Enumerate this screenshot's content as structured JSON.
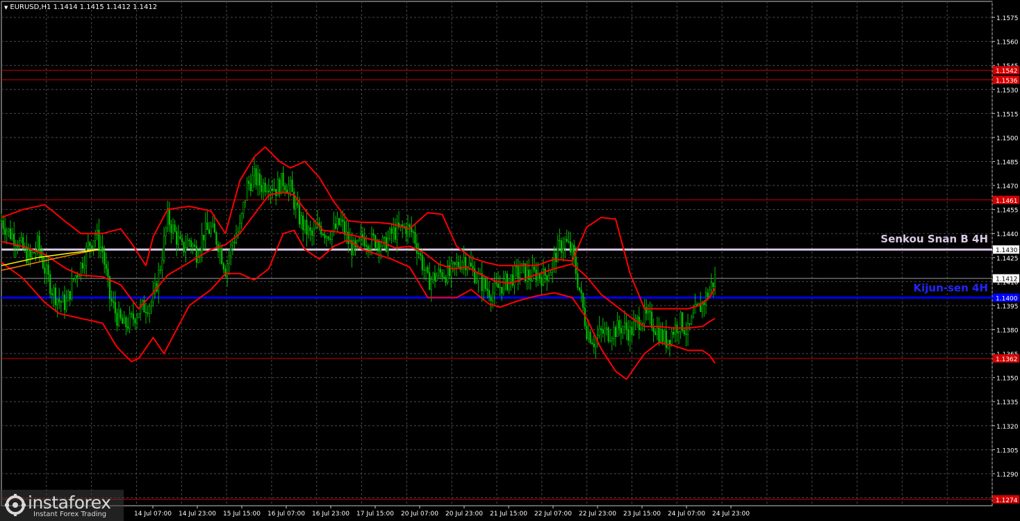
{
  "header": {
    "symbol_line": "EURUSD,H1  1.1414 1.1415 1.1412 1.1412"
  },
  "logo": {
    "name": "instaforex",
    "tagline": "Instant Forex Trading"
  },
  "chart_data": {
    "type": "candlestick",
    "symbol": "EURUSD",
    "timeframe": "H1",
    "ohlc_last": {
      "open": 1.1414,
      "high": 1.1415,
      "low": 1.1412,
      "close": 1.1412
    },
    "ylim": [
      1.127,
      1.1585
    ],
    "y_ticks": [
      "1.1575",
      "1.1560",
      "1.1545",
      "1.1530",
      "1.1515",
      "1.1500",
      "1.1485",
      "1.1470",
      "1.1455",
      "1.1440",
      "1.1425",
      "1.1410",
      "1.1395",
      "1.1380",
      "1.1365",
      "1.1350",
      "1.1335",
      "1.1320",
      "1.1305",
      "1.1290",
      "1.1275"
    ],
    "x_ticks": [
      "14 Jul 07:00",
      "14 Jul 23:00",
      "15 Jul 15:00",
      "16 Jul 07:00",
      "16 Jul 23:00",
      "17 Jul 15:00",
      "20 Jul 07:00",
      "20 Jul 23:00",
      "21 Jul 15:00",
      "22 Jul 07:00",
      "22 Jul 23:00",
      "23 Jul 15:00",
      "24 Jul 07:00",
      "24 Jul 23:00"
    ],
    "grid": true,
    "current_price": "1.1412",
    "levels": [
      {
        "price": 1.1542,
        "label": "1.1542",
        "color": "#d40000",
        "type": "support-resistance"
      },
      {
        "price": 1.1536,
        "label": "1.1536",
        "color": "#d40000",
        "type": "support-resistance"
      },
      {
        "price": 1.1461,
        "label": "1.1461",
        "color": "#d40000",
        "type": "support-resistance"
      },
      {
        "price": 1.1362,
        "label": "1.1362",
        "color": "#d40000",
        "type": "support-resistance"
      },
      {
        "price": 1.1274,
        "label": "1.1274",
        "color": "#d40000",
        "type": "support-resistance"
      },
      {
        "price": 1.143,
        "label": "1.1430",
        "color": "#d9c9e6",
        "type": "senkou-span-b",
        "annotation": "Senkou Snan B 4H"
      },
      {
        "price": 1.14,
        "label": "1.1400",
        "color": "#0000ff",
        "type": "kijun-sen",
        "annotation": "Kijun-sen 4H"
      }
    ],
    "price_series": [
      [
        0,
        1.1448
      ],
      [
        4,
        1.1441
      ],
      [
        8,
        1.1437
      ],
      [
        12,
        1.143
      ],
      [
        16,
        1.1424
      ],
      [
        20,
        1.1433
      ],
      [
        24,
        1.1418
      ],
      [
        28,
        1.1405
      ],
      [
        32,
        1.1398
      ],
      [
        36,
        1.1396
      ],
      [
        40,
        1.1412
      ],
      [
        44,
        1.142
      ],
      [
        48,
        1.1432
      ],
      [
        52,
        1.144
      ],
      [
        56,
        1.1429
      ],
      [
        60,
        1.14
      ],
      [
        64,
        1.1388
      ],
      [
        68,
        1.1382
      ],
      [
        72,
        1.1386
      ],
      [
        76,
        1.1392
      ],
      [
        80,
        1.1395
      ],
      [
        84,
        1.1398
      ],
      [
        88,
        1.142
      ],
      [
        92,
        1.145
      ],
      [
        96,
        1.144
      ],
      [
        100,
        1.143
      ],
      [
        104,
        1.1436
      ],
      [
        108,
        1.1428
      ],
      [
        112,
        1.144
      ],
      [
        116,
        1.1443
      ],
      [
        120,
        1.1434
      ],
      [
        124,
        1.1418
      ],
      [
        128,
        1.1435
      ],
      [
        132,
        1.1443
      ],
      [
        136,
        1.147
      ],
      [
        140,
        1.1475
      ],
      [
        144,
        1.147
      ],
      [
        148,
        1.1472
      ],
      [
        152,
        1.1468
      ],
      [
        156,
        1.1473
      ],
      [
        160,
        1.1468
      ],
      [
        164,
        1.1452
      ],
      [
        168,
        1.1443
      ],
      [
        172,
        1.1438
      ],
      [
        176,
        1.1445
      ],
      [
        180,
        1.144
      ],
      [
        184,
        1.1442
      ],
      [
        188,
        1.1447
      ],
      [
        192,
        1.1435
      ],
      [
        196,
        1.1428
      ],
      [
        200,
        1.1438
      ],
      [
        204,
        1.1435
      ],
      [
        208,
        1.1436
      ],
      [
        212,
        1.1432
      ],
      [
        216,
        1.144
      ],
      [
        220,
        1.1442
      ],
      [
        224,
        1.1444
      ],
      [
        228,
        1.144
      ],
      [
        232,
        1.1425
      ],
      [
        236,
        1.141
      ],
      [
        240,
        1.1413
      ],
      [
        244,
        1.1416
      ],
      [
        248,
        1.1414
      ],
      [
        252,
        1.142
      ],
      [
        256,
        1.1425
      ],
      [
        260,
        1.1418
      ],
      [
        264,
        1.1412
      ],
      [
        268,
        1.1406
      ],
      [
        272,
        1.1403
      ],
      [
        276,
        1.1407
      ],
      [
        280,
        1.141
      ],
      [
        284,
        1.1414
      ],
      [
        288,
        1.1417
      ],
      [
        292,
        1.1413
      ],
      [
        296,
        1.1415
      ],
      [
        300,
        1.1413
      ],
      [
        304,
        1.1418
      ],
      [
        308,
        1.143
      ],
      [
        312,
        1.1435
      ],
      [
        316,
        1.1428
      ],
      [
        320,
        1.1405
      ],
      [
        324,
        1.138
      ],
      [
        328,
        1.1373
      ],
      [
        332,
        1.1378
      ],
      [
        336,
        1.1378
      ],
      [
        340,
        1.138
      ],
      [
        344,
        1.1382
      ],
      [
        348,
        1.1378
      ],
      [
        352,
        1.1385
      ],
      [
        356,
        1.1388
      ],
      [
        360,
        1.1385
      ],
      [
        364,
        1.1378
      ],
      [
        368,
        1.1373
      ],
      [
        372,
        1.138
      ],
      [
        376,
        1.1385
      ],
      [
        380,
        1.1378
      ],
      [
        384,
        1.139
      ],
      [
        388,
        1.1396
      ],
      [
        392,
        1.1405
      ],
      [
        395,
        1.1412
      ]
    ],
    "bollinger_upper": [
      [
        0,
        1.145
      ],
      [
        12,
        1.1455
      ],
      [
        24,
        1.1458
      ],
      [
        36,
        1.1447
      ],
      [
        44,
        1.144
      ],
      [
        56,
        1.144
      ],
      [
        66,
        1.1443
      ],
      [
        72,
        1.1434
      ],
      [
        80,
        1.142
      ],
      [
        84,
        1.1438
      ],
      [
        92,
        1.1455
      ],
      [
        104,
        1.1457
      ],
      [
        116,
        1.1454
      ],
      [
        124,
        1.144
      ],
      [
        132,
        1.1473
      ],
      [
        140,
        1.1488
      ],
      [
        146,
        1.1494
      ],
      [
        154,
        1.1485
      ],
      [
        160,
        1.1481
      ],
      [
        168,
        1.1485
      ],
      [
        176,
        1.1475
      ],
      [
        184,
        1.146
      ],
      [
        192,
        1.1448
      ],
      [
        200,
        1.1447
      ],
      [
        208,
        1.1447
      ],
      [
        216,
        1.1446
      ],
      [
        226,
        1.1443
      ],
      [
        236,
        1.1453
      ],
      [
        244,
        1.1452
      ],
      [
        252,
        1.1432
      ],
      [
        260,
        1.1425
      ],
      [
        268,
        1.1422
      ],
      [
        276,
        1.142
      ],
      [
        284,
        1.142
      ],
      [
        296,
        1.142
      ],
      [
        306,
        1.1424
      ],
      [
        316,
        1.1423
      ],
      [
        324,
        1.1444
      ],
      [
        332,
        1.145
      ],
      [
        340,
        1.1449
      ],
      [
        348,
        1.1415
      ],
      [
        356,
        1.1393
      ],
      [
        364,
        1.1393
      ],
      [
        372,
        1.1393
      ],
      [
        380,
        1.1393
      ],
      [
        386,
        1.1395
      ],
      [
        392,
        1.14
      ],
      [
        395,
        1.1406
      ]
    ],
    "bollinger_middle": [
      [
        0,
        1.1435
      ],
      [
        12,
        1.1432
      ],
      [
        24,
        1.1427
      ],
      [
        36,
        1.1418
      ],
      [
        44,
        1.1414
      ],
      [
        56,
        1.1413
      ],
      [
        66,
        1.1408
      ],
      [
        76,
        1.1393
      ],
      [
        84,
        1.1403
      ],
      [
        92,
        1.1414
      ],
      [
        104,
        1.1422
      ],
      [
        116,
        1.143
      ],
      [
        124,
        1.1433
      ],
      [
        132,
        1.144
      ],
      [
        140,
        1.1452
      ],
      [
        148,
        1.1464
      ],
      [
        156,
        1.1466
      ],
      [
        162,
        1.1464
      ],
      [
        170,
        1.1452
      ],
      [
        178,
        1.1442
      ],
      [
        186,
        1.1441
      ],
      [
        194,
        1.1439
      ],
      [
        202,
        1.1437
      ],
      [
        210,
        1.1435
      ],
      [
        218,
        1.1431
      ],
      [
        226,
        1.1432
      ],
      [
        234,
        1.1428
      ],
      [
        242,
        1.1421
      ],
      [
        250,
        1.1418
      ],
      [
        258,
        1.1419
      ],
      [
        266,
        1.1414
      ],
      [
        274,
        1.141
      ],
      [
        282,
        1.1409
      ],
      [
        290,
        1.1412
      ],
      [
        298,
        1.1415
      ],
      [
        306,
        1.1418
      ],
      [
        316,
        1.1421
      ],
      [
        324,
        1.1413
      ],
      [
        332,
        1.1402
      ],
      [
        340,
        1.1395
      ],
      [
        348,
        1.1388
      ],
      [
        356,
        1.1382
      ],
      [
        364,
        1.1382
      ],
      [
        372,
        1.1381
      ],
      [
        380,
        1.1381
      ],
      [
        388,
        1.1382
      ],
      [
        392,
        1.1385
      ],
      [
        395,
        1.1387
      ]
    ],
    "bollinger_lower": [
      [
        0,
        1.1422
      ],
      [
        12,
        1.1412
      ],
      [
        24,
        1.1397
      ],
      [
        32,
        1.139
      ],
      [
        44,
        1.1387
      ],
      [
        56,
        1.1384
      ],
      [
        64,
        1.1369
      ],
      [
        72,
        1.136
      ],
      [
        76,
        1.1362
      ],
      [
        84,
        1.1375
      ],
      [
        90,
        1.1365
      ],
      [
        96,
        1.1378
      ],
      [
        104,
        1.1395
      ],
      [
        116,
        1.1405
      ],
      [
        124,
        1.1415
      ],
      [
        132,
        1.1415
      ],
      [
        140,
        1.1411
      ],
      [
        148,
        1.1418
      ],
      [
        156,
        1.144
      ],
      [
        162,
        1.1442
      ],
      [
        168,
        1.143
      ],
      [
        176,
        1.1424
      ],
      [
        184,
        1.1432
      ],
      [
        192,
        1.1436
      ],
      [
        200,
        1.143
      ],
      [
        208,
        1.1427
      ],
      [
        216,
        1.1424
      ],
      [
        226,
        1.1419
      ],
      [
        236,
        1.14
      ],
      [
        244,
        1.14
      ],
      [
        252,
        1.14
      ],
      [
        260,
        1.1405
      ],
      [
        270,
        1.1396
      ],
      [
        276,
        1.1394
      ],
      [
        286,
        1.1398
      ],
      [
        296,
        1.1401
      ],
      [
        306,
        1.1403
      ],
      [
        316,
        1.14
      ],
      [
        324,
        1.1387
      ],
      [
        332,
        1.1368
      ],
      [
        340,
        1.1354
      ],
      [
        346,
        1.1349
      ],
      [
        356,
        1.1365
      ],
      [
        364,
        1.1372
      ],
      [
        372,
        1.137
      ],
      [
        380,
        1.1367
      ],
      [
        388,
        1.1367
      ],
      [
        392,
        1.1364
      ],
      [
        395,
        1.1359
      ]
    ],
    "ichimoku_yellow": [
      [
        0,
        1.142
      ],
      [
        20,
        1.1425
      ],
      [
        40,
        1.1428
      ],
      [
        54,
        1.143
      ]
    ],
    "ichimoku_orange": [
      [
        0,
        1.1417
      ],
      [
        20,
        1.1422
      ],
      [
        40,
        1.1427
      ],
      [
        54,
        1.143
      ]
    ],
    "colors": {
      "background": "#000000",
      "candles": "#00c000",
      "bollinger": "#ff0000",
      "grid": "#4a4a4a",
      "axis_text": "#ffffff"
    }
  }
}
